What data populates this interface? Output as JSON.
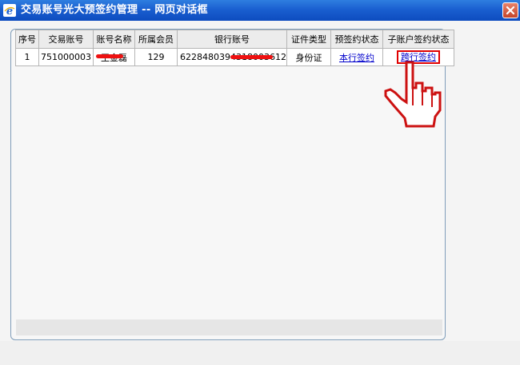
{
  "window": {
    "title": "交易账号光大预签约管理 -- 网页对话框"
  },
  "table": {
    "columns": [
      "序号",
      "交易账号",
      "账号名称",
      "所属会员",
      "银行账号",
      "证件类型",
      "预签约状态",
      "子账户签约状态"
    ],
    "rows": [
      {
        "seq": "1",
        "account": "751000003",
        "account_name": "王金磊",
        "member": "129",
        "bank_account": "6228480394318003612",
        "id_type": "身份证",
        "pre_sign_status": "本行签约",
        "sub_sign_status": "跨行签约"
      }
    ]
  },
  "icons": {
    "app": "ie-app-icon",
    "close": "close-icon",
    "pointer": "hand-pointer-icon"
  },
  "colors": {
    "title_bar": "#1a5fd0",
    "link": "#0000cc",
    "highlight": "#e00000",
    "border": "#7f9db9"
  }
}
